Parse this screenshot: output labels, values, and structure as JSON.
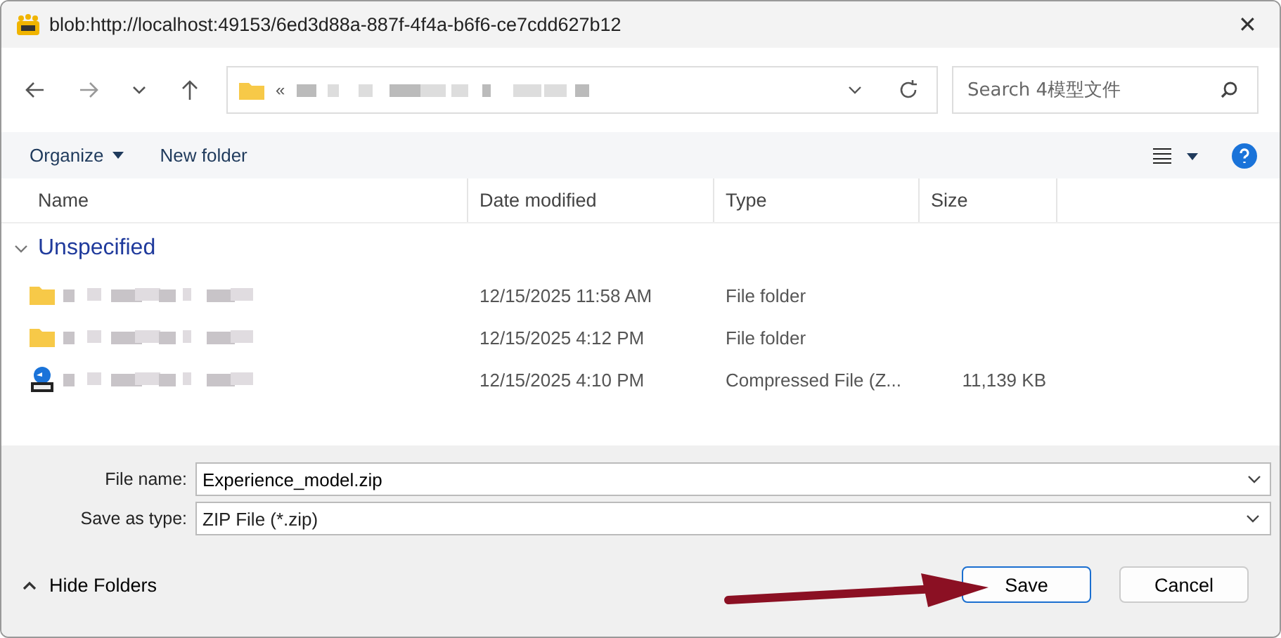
{
  "window": {
    "title": "blob:http://localhost:49153/6ed3d88a-887f-4f4a-b6f6-ce7cdd627b12",
    "close": "✕"
  },
  "address": {
    "prefix": "«"
  },
  "search": {
    "placeholder": "Search 4模型文件"
  },
  "toolbar": {
    "organize": "Organize",
    "new_folder": "New folder"
  },
  "table": {
    "columns": [
      "Name",
      "Date modified",
      "Type",
      "Size"
    ],
    "group": {
      "label": "Unspecified",
      "expanded": true
    },
    "rows": [
      {
        "kind": "folder",
        "date": "12/15/2025 11:58 AM",
        "type": "File folder",
        "size": ""
      },
      {
        "kind": "folder",
        "date": "12/15/2025 4:12 PM",
        "type": "File folder",
        "size": ""
      },
      {
        "kind": "zip",
        "date": "12/15/2025 4:10 PM",
        "type": "Compressed File (Z...",
        "size": "11,139 KB"
      }
    ]
  },
  "form": {
    "file_name_label": "File name:",
    "file_name": "Experience_model.zip",
    "type_label": "Save as type:",
    "type_value": "ZIP File (*.zip)"
  },
  "footer": {
    "hide_folders": "Hide Folders",
    "save": "Save",
    "cancel": "Cancel"
  }
}
